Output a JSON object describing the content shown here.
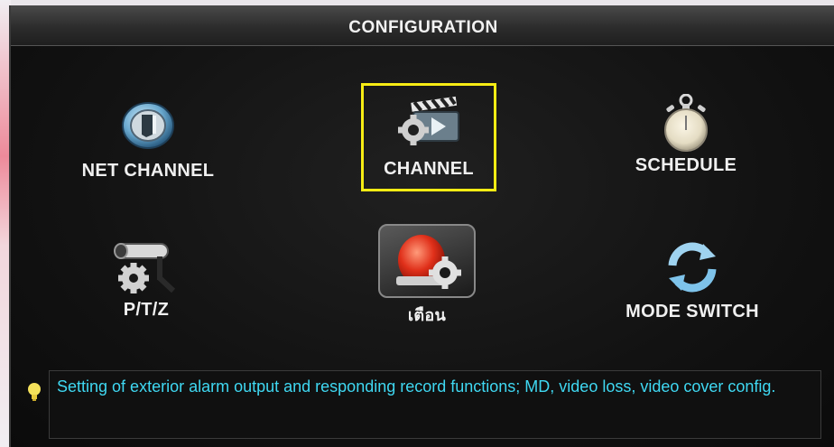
{
  "header": {
    "title": "CONFIGURATION"
  },
  "menu": {
    "items": [
      {
        "label": "NET CHANNEL",
        "icon": "network-globe-icon"
      },
      {
        "label": "CHANNEL",
        "icon": "clapperboard-gear-icon",
        "selected": true
      },
      {
        "label": "SCHEDULE",
        "icon": "stopwatch-icon"
      },
      {
        "label": "P/T/Z",
        "icon": "camera-gear-icon"
      },
      {
        "label": "เตือน",
        "icon": "alarm-siren-gear-icon"
      },
      {
        "label": "MODE SWITCH",
        "icon": "refresh-arrows-icon"
      }
    ]
  },
  "hint": {
    "icon": "lightbulb-icon",
    "text": "Setting of exterior alarm output and responding record functions; MD, video loss, video cover config."
  },
  "colors": {
    "selection": "#f7ec14",
    "hint_text": "#3fd8f2",
    "label": "#f0f0f0"
  }
}
